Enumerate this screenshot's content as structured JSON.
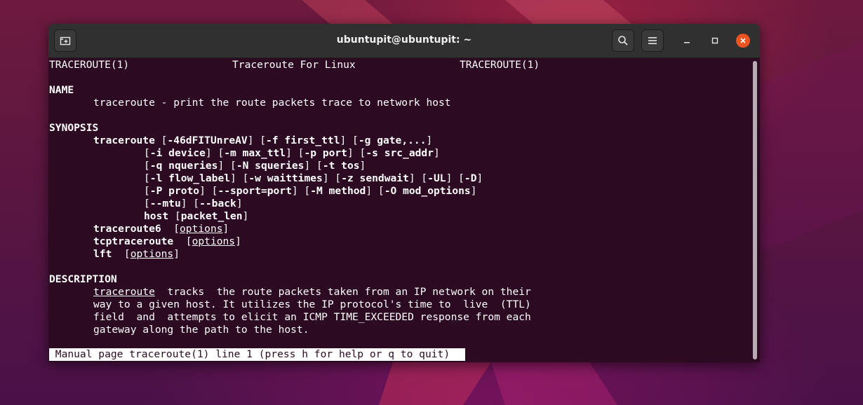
{
  "window": {
    "title": "ubuntupit@ubuntupit: ~"
  },
  "icons": {
    "new_tab": "new-tab-icon",
    "search": "search-icon",
    "menu": "hamburger-menu-icon",
    "minimize": "minimize-icon",
    "maximize": "maximize-icon",
    "close": "close-icon"
  },
  "colors": {
    "terminal_bg": "#2c0a22",
    "titlebar_bg": "#303030",
    "close_button": "#e95420",
    "text": "#ffffff"
  },
  "man": {
    "header_left": "TRACEROUTE(1)",
    "header_center": "Traceroute For Linux",
    "header_right": "TRACEROUTE(1)",
    "name_heading": "NAME",
    "name_text": "traceroute - print the route packets trace to network host",
    "synopsis_heading": "SYNOPSIS",
    "syn_cmd": "traceroute",
    "syn_1a": " [",
    "syn_1b": "-46dFITUnreAV",
    "syn_1c": "] [",
    "syn_1d": "-f first_ttl",
    "syn_1e": "] [",
    "syn_1f": "-g gate,...",
    "syn_1g": "]",
    "syn_2a": "[",
    "syn_2b": "-i device",
    "syn_2c": "] [",
    "syn_2d": "-m max_ttl",
    "syn_2e": "] [",
    "syn_2f": "-p port",
    "syn_2g": "] [",
    "syn_2h": "-s src_addr",
    "syn_2i": "]",
    "syn_3a": "[",
    "syn_3b": "-q nqueries",
    "syn_3c": "] [",
    "syn_3d": "-N squeries",
    "syn_3e": "] [",
    "syn_3f": "-t tos",
    "syn_3g": "]",
    "syn_4a": "[",
    "syn_4b": "-l flow_label",
    "syn_4c": "] [",
    "syn_4d": "-w waittimes",
    "syn_4e": "] [",
    "syn_4f": "-z sendwait",
    "syn_4g": "] [",
    "syn_4h": "-UL",
    "syn_4i": "] [",
    "syn_4j": "-D",
    "syn_4k": "]",
    "syn_5a": "[",
    "syn_5b": "-P proto",
    "syn_5c": "] [",
    "syn_5d": "--sport=port",
    "syn_5e": "] [",
    "syn_5f": "-M method",
    "syn_5g": "] [",
    "syn_5h": "-O mod_options",
    "syn_5i": "]",
    "syn_6a": "[",
    "syn_6b": "--mtu",
    "syn_6c": "] [",
    "syn_6d": "--back",
    "syn_6e": "]",
    "syn_7a": "host",
    "syn_7b": " [",
    "syn_7c": "packet_len",
    "syn_7d": "]",
    "alt1_cmd": "traceroute6",
    "alt1_sep": "  [",
    "alt1_opt": "options",
    "alt1_end": "]",
    "alt2_cmd": "tcptraceroute",
    "alt2_sep": "  [",
    "alt2_opt": "options",
    "alt2_end": "]",
    "alt3_cmd": "lft",
    "alt3_sep": "  [",
    "alt3_opt": "options",
    "alt3_end": "]",
    "description_heading": "DESCRIPTION",
    "desc_1_link": "traceroute",
    "desc_1_rest": "  tracks  the route packets taken from an IP network on their",
    "desc_2": "way to a given host. It utilizes the IP protocol's time to  live  (TTL)",
    "desc_3": "field  and  attempts to elicit an ICMP TIME_EXCEEDED response from each",
    "desc_4": "gateway along the path to the host."
  },
  "status_line": " Manual page traceroute(1) line 1 (press h for help or q to quit)"
}
